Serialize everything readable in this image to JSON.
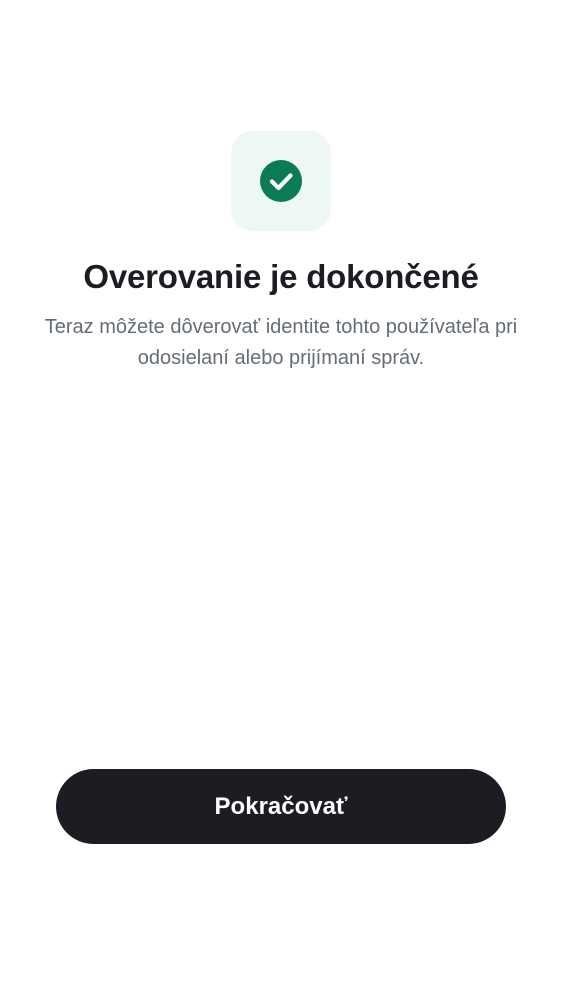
{
  "status": {
    "icon": "check-circle-icon",
    "accent_color": "#0b7a57",
    "badge_color": "#eef8f3"
  },
  "title": "Overovanie je dokončené",
  "subtitle": "Teraz môžete dôverovať identite tohto používateľa pri odosielaní alebo prijímaní správ.",
  "actions": {
    "continue_label": "Pokračovať",
    "button_color": "#1b1d22"
  }
}
